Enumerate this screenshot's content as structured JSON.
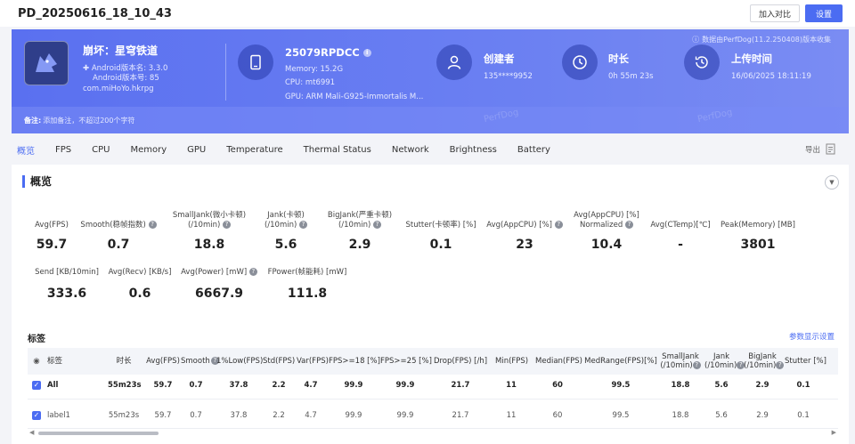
{
  "header": {
    "title": "PD_20250616_18_10_43",
    "btn_compare": "加入对比",
    "btn_settings": "设置"
  },
  "banner": {
    "notice": "数据由PerfDog(11.2.250408)版本收集",
    "app": {
      "name": "崩坏：星穹铁道",
      "version_name": "Android版本名: 3.3.0",
      "version_code": "Android版本号: 85",
      "package": "com.miHoYo.hkrpg"
    },
    "device": {
      "name": "25079RPDCC",
      "memory": "Memory: 15.2G",
      "cpu": "CPU: mt6991",
      "gpu": "GPU: ARM Mali-G925-Immortalis M..."
    },
    "creator": {
      "title": "创建者",
      "value": "135****9952"
    },
    "duration": {
      "title": "时长",
      "value": "0h 55m 23s"
    },
    "upload": {
      "title": "上传时间",
      "value": "16/06/2025 18:11:19"
    },
    "remark_label": "备注:",
    "remark_placeholder": "添加备注，不超过200个字符",
    "watermark": "PerfDog"
  },
  "tabs": [
    "概览",
    "FPS",
    "CPU",
    "Memory",
    "GPU",
    "Temperature",
    "Thermal Status",
    "Network",
    "Brightness",
    "Battery"
  ],
  "export_label": "导出",
  "overview": {
    "title": "概览",
    "metrics_row1": [
      {
        "label1": "Avg(FPS)",
        "label2": "",
        "value": "59.7",
        "help": false
      },
      {
        "label1": "Smooth(稳帧指数)",
        "label2": "",
        "value": "0.7",
        "help": true
      },
      {
        "label1": "SmallJank(微小卡顿)",
        "label2": "(/10min)",
        "value": "18.8",
        "help": true
      },
      {
        "label1": "Jank(卡顿)",
        "label2": "(/10min)",
        "value": "5.6",
        "help": true
      },
      {
        "label1": "BigJank(严重卡顿)",
        "label2": "(/10min)",
        "value": "2.9",
        "help": true
      },
      {
        "label1": "Stutter(卡顿率) [%]",
        "label2": "",
        "value": "0.1",
        "help": false
      },
      {
        "label1": "Avg(AppCPU) [%]",
        "label2": "",
        "value": "23",
        "help": true
      },
      {
        "label1": "Avg(AppCPU) [%]",
        "label2": "Normalized",
        "value": "10.4",
        "help": true
      },
      {
        "label1": "Avg(CTemp)[℃]",
        "label2": "",
        "value": "-",
        "help": false
      },
      {
        "label1": "Peak(Memory) [MB]",
        "label2": "",
        "value": "3801",
        "help": false
      }
    ],
    "metrics_row2": [
      {
        "label1": "Send [KB/10min]",
        "value": "333.6",
        "help": false
      },
      {
        "label1": "Avg(Recv) [KB/s]",
        "value": "0.6",
        "help": false
      },
      {
        "label1": "Avg(Power) [mW]",
        "value": "6667.9",
        "help": true
      },
      {
        "label1": "FPower(帧能耗) [mW]",
        "value": "111.8",
        "help": false
      }
    ]
  },
  "tags": {
    "title": "标签",
    "settings_link": "参数显示设置",
    "columns": [
      {
        "l1": "标签",
        "l2": ""
      },
      {
        "l1": "时长",
        "l2": ""
      },
      {
        "l1": "Avg(FPS)",
        "l2": ""
      },
      {
        "l1": "Smooth",
        "l2": ""
      },
      {
        "l1": "1%Low(FPS)",
        "l2": ""
      },
      {
        "l1": "Std(FPS)",
        "l2": ""
      },
      {
        "l1": "Var(FPS)",
        "l2": ""
      },
      {
        "l1": "FPS>=18 [%]",
        "l2": ""
      },
      {
        "l1": "FPS>=25 [%]",
        "l2": ""
      },
      {
        "l1": "Drop(FPS) [/h]",
        "l2": ""
      },
      {
        "l1": "Min(FPS)",
        "l2": ""
      },
      {
        "l1": "Median(FPS)",
        "l2": ""
      },
      {
        "l1": "MedRange(FPS)[%]",
        "l2": ""
      },
      {
        "l1": "SmallJank",
        "l2": "(/10min)"
      },
      {
        "l1": "Jank",
        "l2": "(/10min)"
      },
      {
        "l1": "BigJank",
        "l2": "(/10min)"
      },
      {
        "l1": "Stutter [%]",
        "l2": ""
      }
    ],
    "rows": [
      {
        "cells": [
          "All",
          "55m23s",
          "59.7",
          "0.7",
          "37.8",
          "2.2",
          "4.7",
          "99.9",
          "99.9",
          "21.7",
          "11",
          "60",
          "99.5",
          "18.8",
          "5.6",
          "2.9",
          "0.1"
        ],
        "bold": true
      },
      {
        "cells": [
          "label1",
          "55m23s",
          "59.7",
          "0.7",
          "37.8",
          "2.2",
          "4.7",
          "99.9",
          "99.9",
          "21.7",
          "11",
          "60",
          "99.5",
          "18.8",
          "5.6",
          "2.9",
          "0.1"
        ],
        "bold": false
      }
    ]
  },
  "colors": {
    "accent": "#4b6cf2",
    "banner": "#5a70f0"
  }
}
